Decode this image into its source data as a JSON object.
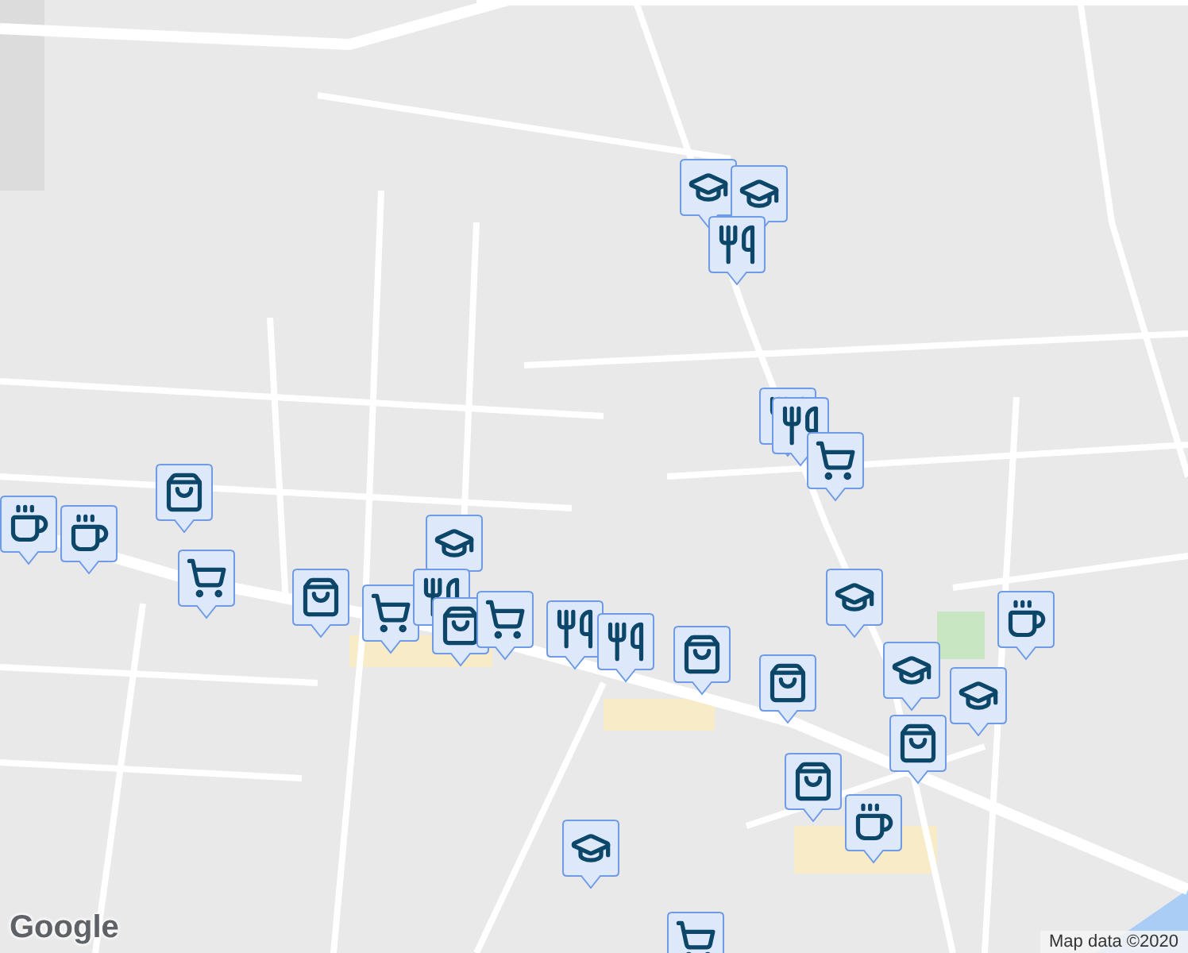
{
  "map": {
    "markers": [
      {
        "kind": "school"
      },
      {
        "kind": "school"
      },
      {
        "kind": "restaurant"
      },
      {
        "kind": "restaurant"
      },
      {
        "kind": "restaurant"
      },
      {
        "kind": "cart"
      },
      {
        "kind": "school"
      },
      {
        "kind": "cafe"
      },
      {
        "kind": "cafe"
      },
      {
        "kind": "shopping"
      },
      {
        "kind": "cart"
      },
      {
        "kind": "shopping"
      },
      {
        "kind": "cart"
      },
      {
        "kind": "restaurant"
      },
      {
        "kind": "shopping"
      },
      {
        "kind": "cart"
      },
      {
        "kind": "restaurant"
      },
      {
        "kind": "restaurant"
      },
      {
        "kind": "shopping"
      },
      {
        "kind": "shopping"
      },
      {
        "kind": "school"
      },
      {
        "kind": "cafe"
      },
      {
        "kind": "school"
      },
      {
        "kind": "school"
      },
      {
        "kind": "shopping"
      },
      {
        "kind": "shopping"
      },
      {
        "kind": "cafe"
      },
      {
        "kind": "school"
      },
      {
        "kind": "cart"
      }
    ]
  },
  "attribution": {
    "logo": "Google",
    "text": "Map data ©2020"
  }
}
